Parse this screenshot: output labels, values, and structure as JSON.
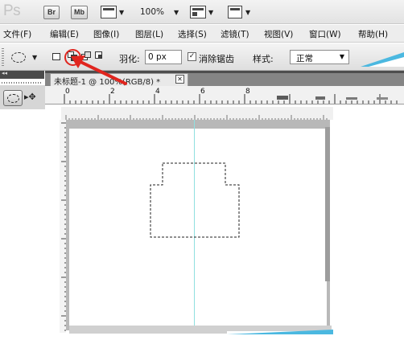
{
  "app": {
    "logo": "Ps",
    "bridge_btn": "Br",
    "minibridge_btn": "Mb",
    "zoom": "100%"
  },
  "menu": [
    "文件(F)",
    "编辑(E)",
    "图像(I)",
    "图层(L)",
    "选择(S)",
    "滤镜(T)",
    "视图(V)",
    "窗口(W)",
    "帮助(H)"
  ],
  "options": {
    "feather_label": "羽化:",
    "feather_value": "0 px",
    "antialias_checked": true,
    "antialias_label": "消除锯齿",
    "style_label": "样式:",
    "style_value": "正常",
    "selection_mode_active": "add-to-selection",
    "highlight_color": "#e0251e"
  },
  "document": {
    "tab_title": "未标题-1 @ 100%(RGB/8) *",
    "close_glyph": "✕"
  },
  "ruler": {
    "h_numbers": [
      "0",
      "2",
      "4",
      "6",
      "8"
    ]
  },
  "icons": {
    "tool_marquee": "elliptical-marquee-icon",
    "tool_move": "move-icon",
    "arrange": "arrange-documents-icon",
    "screen_mode": "screen-mode-icon"
  }
}
